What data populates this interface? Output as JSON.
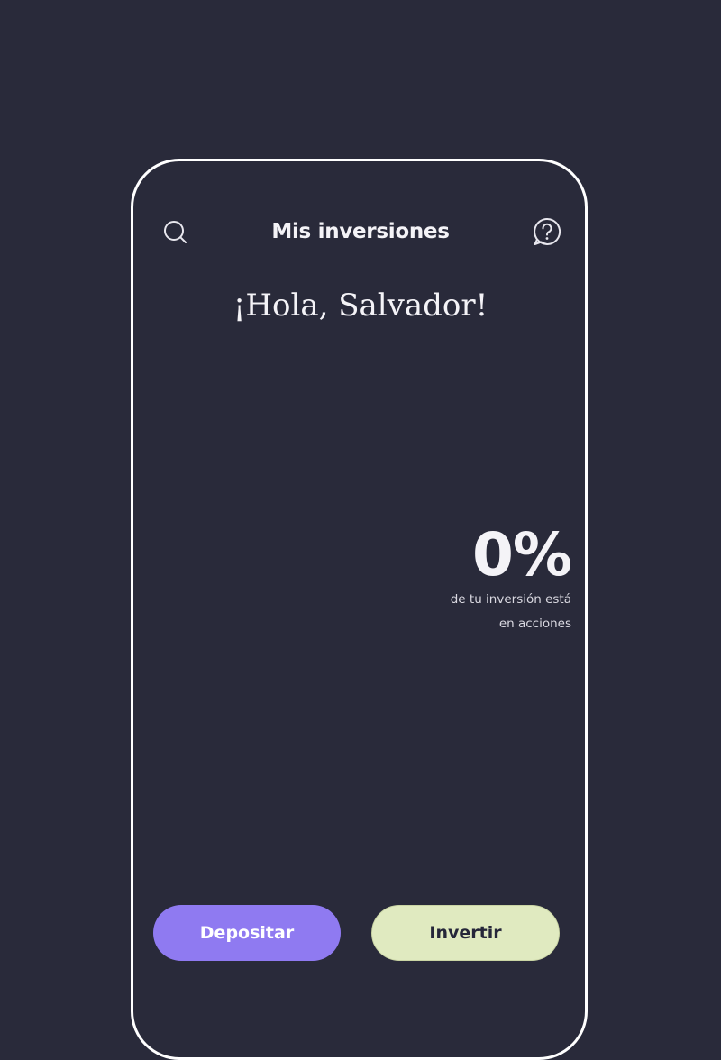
{
  "header": {
    "title": "Mis inversiones",
    "left_icon": "search-icon",
    "right_icon": "help-icon"
  },
  "greeting": "¡Hola, Salvador!",
  "stat": {
    "value": "0%",
    "caption_line1": "de tu inversión está",
    "caption_line2": "en acciones",
    "stock_allocation_percent": 0
  },
  "actions": {
    "deposit_label": "Depositar",
    "invest_label": "Invertir"
  },
  "colors": {
    "background": "#292a3a",
    "frame": "#ffffff",
    "deposit_button": "#8f7af1",
    "invest_button": "#e0eac0"
  }
}
